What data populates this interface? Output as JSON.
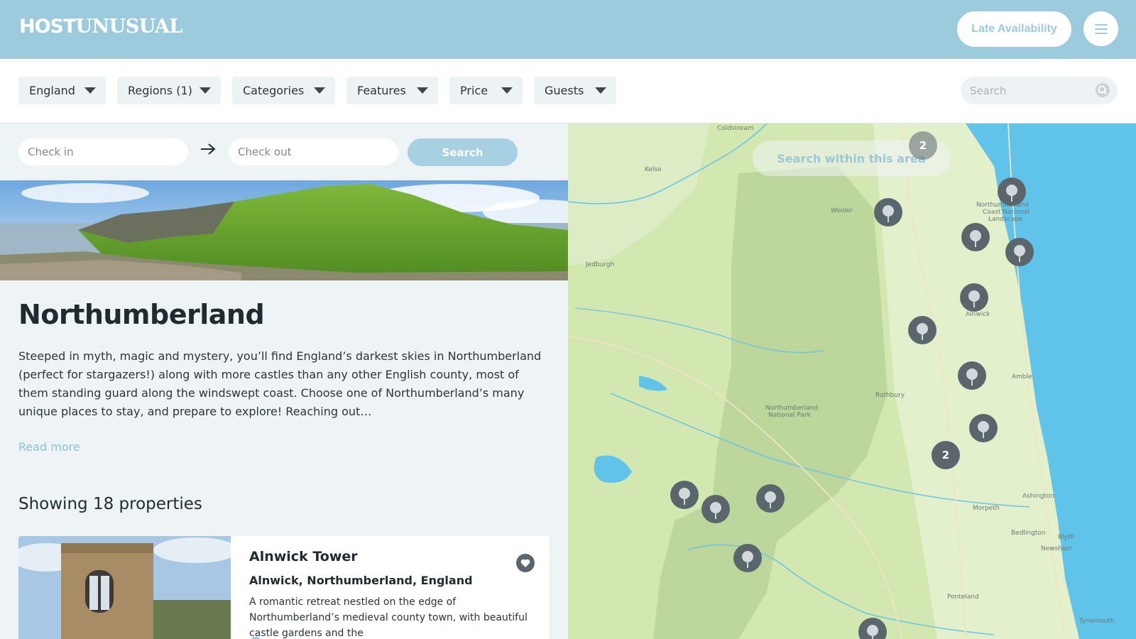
{
  "header": {
    "logo_part1": "HOST",
    "logo_part2": "UNUSUAL",
    "late_availability": "Late Availability",
    "menu_icon": "hamburger-menu-icon",
    "bg_color": "#9ccbde"
  },
  "filters": {
    "items": [
      {
        "label": "England"
      },
      {
        "label": "Regions (1)"
      },
      {
        "label": "Categories"
      },
      {
        "label": "Features"
      },
      {
        "label": "Price"
      },
      {
        "label": "Guests"
      }
    ],
    "search_placeholder": "Search",
    "search_icon": "search-icon"
  },
  "dates": {
    "check_in_placeholder": "Check in",
    "check_out_placeholder": "Check out",
    "arrow_icon": "arrow-right-icon",
    "search_label": "Search"
  },
  "region": {
    "title": "Northumberland",
    "description": "Steeped in myth, magic and mystery, you’ll find England’s darkest skies in Northumberland (perfect for stargazers!) along with more castles than any other English county, most of them standing guard along the windswept coast.  Choose one of Northumberland’s many unique places to stay, and prepare to explore! Reaching out…",
    "read_more": "Read more",
    "showing": "Showing 18 properties"
  },
  "property": {
    "title": "Alnwick Tower",
    "location": "Alnwick, Northumberland, England",
    "description": "A romantic retreat nestled on the edge of Northumberland’s medieval county town, with beautiful castle gardens and the",
    "favourite_icon": "heart-icon"
  },
  "map": {
    "search_within": "Search within this area",
    "labels": {
      "coldstream": "Coldstream",
      "kelso": "Kelso",
      "wooler": "Wooler",
      "jedburgh": "Jedburgh",
      "coast_1": "Northumberland",
      "coast_2": "Coast National",
      "coast_3": "Landscape",
      "alnwick": "Alnwick",
      "amble": "Amble",
      "rothbury": "Rothbury",
      "np_1": "Northumberland",
      "np_2": "National Park",
      "ashington": "Ashington",
      "morpeth": "Morpeth",
      "bedlington": "Bedlington",
      "blyth": "Blyth",
      "newsham": "Newsham",
      "ponteland": "Ponteland",
      "tynemouth": "Tynemouth"
    },
    "cluster_top": "2",
    "cluster_mid": "2",
    "pin_icon": "map-pin-icon"
  }
}
